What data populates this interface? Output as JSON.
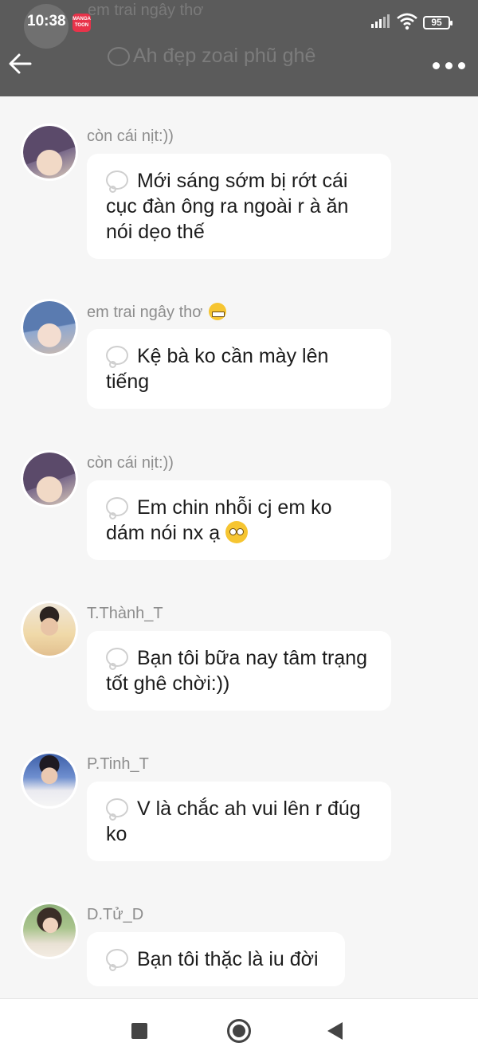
{
  "status": {
    "time": "10:38",
    "battery": "95",
    "app_badge": "MANGA TOON"
  },
  "header_ghost": {
    "name": "em trai ngây thơ",
    "message": "Ah đẹp zoai phũ ghê"
  },
  "messages": [
    {
      "name": "còn cái nịt:))",
      "text": "Mới sáng sớm bị rớt cái cục đàn ông ra ngoài r à ăn nói dẹo thế",
      "avatar": "avatar-anime-purple-hair"
    },
    {
      "name": "em trai ngây thơ",
      "text": "Kệ bà ko cần mày lên tiếng",
      "avatar": "avatar-anime-blue-hair"
    },
    {
      "name": "còn cái nịt:))",
      "text": "Em chin nhỗi cj em ko dám nói nx ạ",
      "avatar": "avatar-anime-purple-hair"
    },
    {
      "name": "T.Thành_T",
      "text": "Bạn tôi bữa nay tâm trạng tốt ghê chời:))",
      "avatar": "avatar-photo-boy"
    },
    {
      "name": "P.Tinh_T",
      "text": "V là chắc ah vui lên r đúg ko",
      "avatar": "avatar-photo-boy-blue"
    },
    {
      "name": "D.Tử_D",
      "text": "Bạn tôi thặc là iu đời",
      "avatar": "avatar-photo-girl"
    }
  ]
}
